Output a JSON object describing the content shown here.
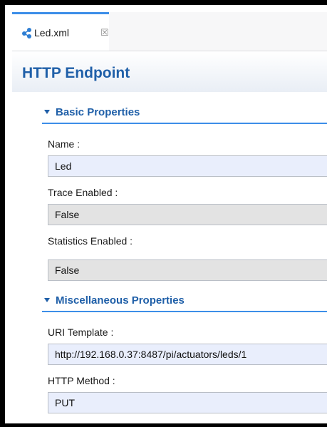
{
  "tab": {
    "icon": "xml-config-icon",
    "label": "Led.xml",
    "close_glyph": "☒"
  },
  "editor": {
    "title": "HTTP Endpoint"
  },
  "sections": {
    "basic": {
      "title": "Basic Properties",
      "name_label": "Name :",
      "name_value": "Led",
      "trace_label": "Trace Enabled :",
      "trace_value": "False",
      "stats_label": "Statistics Enabled :",
      "stats_value": "False"
    },
    "misc": {
      "title": "Miscellaneous Properties",
      "uri_label": "URI Template :",
      "uri_value": "http://192.168.0.37:8487/pi/actuators/leds/1",
      "method_label": "HTTP Method :",
      "method_value": "PUT"
    }
  },
  "colors": {
    "accent": "#3c8ee8",
    "title": "#1f5fa8",
    "editable_bg": "#e9eefc",
    "readonly_bg": "#e3e3e3"
  }
}
